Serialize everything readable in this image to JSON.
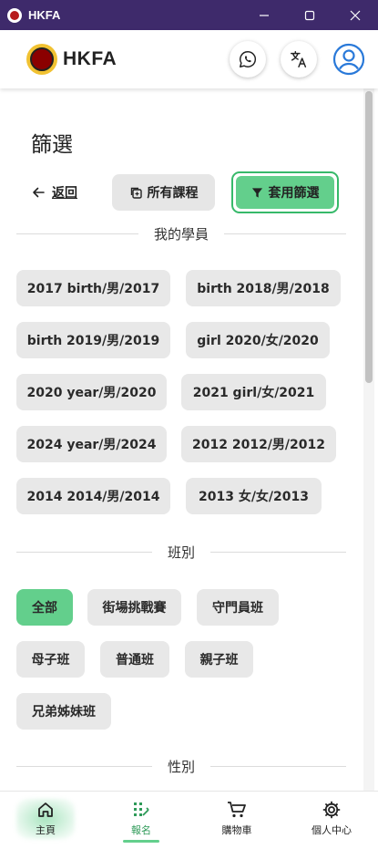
{
  "window": {
    "title": "HKFA"
  },
  "header": {
    "brand": "HKFA"
  },
  "filter": {
    "title": "篩選",
    "back_label": "返回",
    "all_courses_label": "所有課程",
    "apply_label": "套用篩選"
  },
  "students": {
    "heading": "我的學員",
    "items": [
      "2017 birth/男/2017",
      "birth 2018/男/2018",
      "birth 2019/男/2019",
      "girl 2020/女/2020",
      "2020 year/男/2020",
      "2021 girl/女/2021",
      "2024 year/男/2024",
      "2012 2012/男/2012",
      "2014 2014/男/2014",
      "2013 女/女/2013"
    ]
  },
  "classes": {
    "heading": "班別",
    "selected": "全部",
    "items": [
      "全部",
      "街場挑戰賽",
      "守門員班",
      "母子班",
      "普通班",
      "親子班",
      "兄弟姊妹班"
    ]
  },
  "gender": {
    "heading": "性別"
  },
  "bottom_nav": {
    "items": [
      "主頁",
      "報名",
      "購物車",
      "個人中心"
    ],
    "active": "報名"
  },
  "colors": {
    "accent": "#63cf8c",
    "titlebar": "#3e2a6b",
    "chip": "#e8e8e8"
  }
}
